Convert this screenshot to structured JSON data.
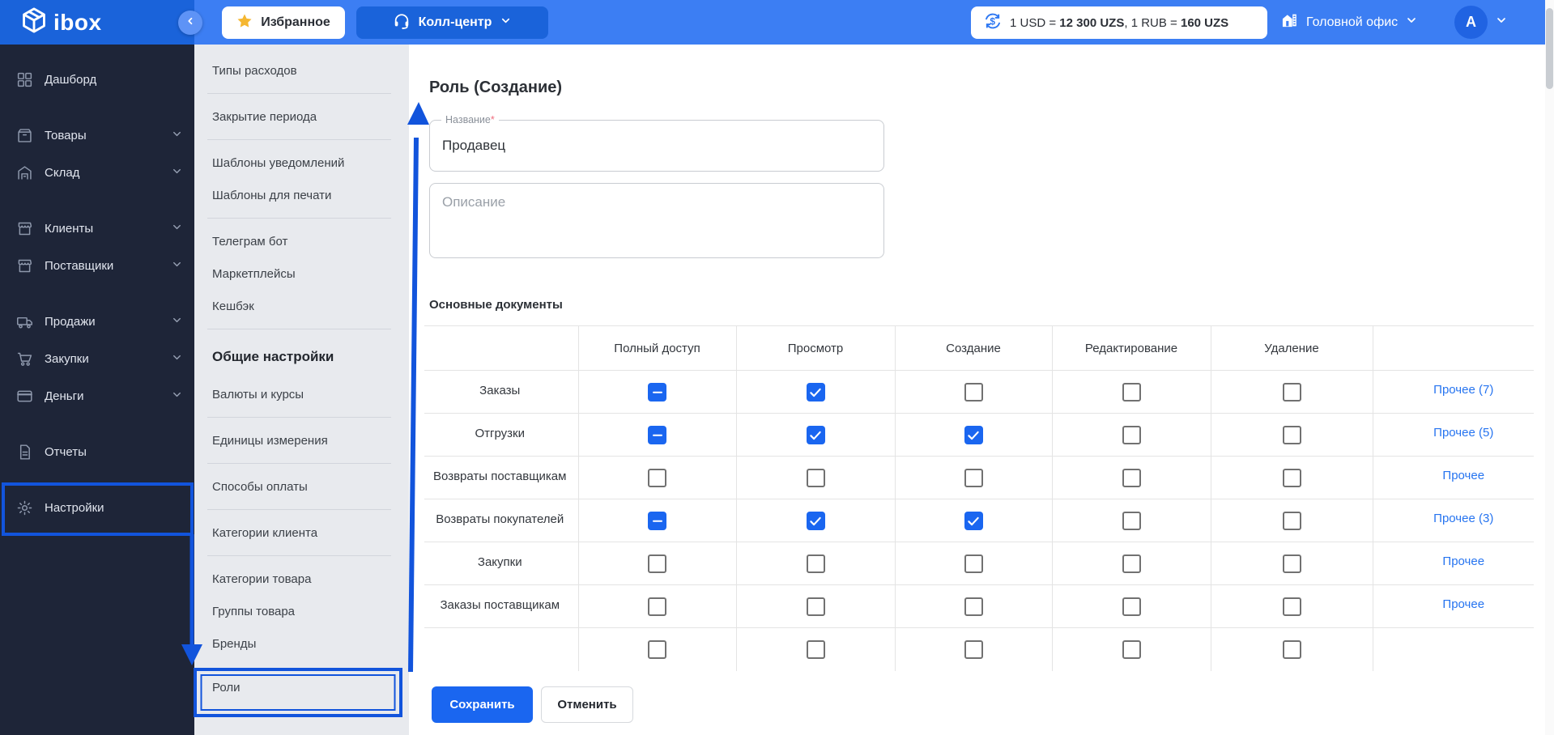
{
  "topbar": {
    "logo_text": "ibox",
    "favorites_label": "Избранное",
    "callcenter_label": "Колл-центр",
    "rates": {
      "r1_label": "1 USD",
      "eq": "=",
      "r1_value": "12 300 UZS",
      "sep": ",",
      "r2_label": "1 RUB",
      "r2_value": "160 UZS"
    },
    "office_label": "Головной офис",
    "avatar_initial": "A"
  },
  "sidebar": {
    "items": [
      {
        "label": "Дашборд",
        "icon": "dashboard-grid-icon",
        "chevron": false,
        "gap": false
      },
      {
        "label": "Товары",
        "icon": "products-box-icon",
        "chevron": true,
        "gap": true
      },
      {
        "label": "Склад",
        "icon": "warehouse-icon",
        "chevron": true,
        "gap": false
      },
      {
        "label": "Клиенты",
        "icon": "clients-store-icon",
        "chevron": true,
        "gap": true
      },
      {
        "label": "Поставщики",
        "icon": "suppliers-store-icon",
        "chevron": true,
        "gap": false
      },
      {
        "label": "Продажи",
        "icon": "sales-truck-icon",
        "chevron": true,
        "gap": true
      },
      {
        "label": "Закупки",
        "icon": "purchases-cart-icon",
        "chevron": true,
        "gap": false
      },
      {
        "label": "Деньги",
        "icon": "money-card-icon",
        "chevron": true,
        "gap": false
      },
      {
        "label": "Отчеты",
        "icon": "reports-doc-icon",
        "chevron": false,
        "gap": true
      },
      {
        "label": "Настройки",
        "icon": "settings-gear-icon",
        "chevron": false,
        "gap": true
      }
    ]
  },
  "settings_menu": {
    "items": [
      {
        "label": "Типы расходов",
        "divider_after": true
      },
      {
        "label": "Закрытие периода",
        "divider_after": true
      },
      {
        "label": "Шаблоны уведомлений",
        "divider_after": false
      },
      {
        "label": "Шаблоны для печати",
        "divider_after": true
      },
      {
        "label": "Телеграм бот",
        "divider_after": false
      },
      {
        "label": "Маркетплейсы",
        "divider_after": false
      },
      {
        "label": "Кешбэк",
        "divider_after": true
      },
      {
        "label": "Общие настройки",
        "header": true
      },
      {
        "label": "Валюты и курсы",
        "divider_after": true
      },
      {
        "label": "Единицы измерения",
        "divider_after": true
      },
      {
        "label": "Способы оплаты",
        "divider_after": true
      },
      {
        "label": "Категории клиента",
        "divider_after": true
      },
      {
        "label": "Категории товара",
        "divider_after": false
      },
      {
        "label": "Группы товара",
        "divider_after": false
      },
      {
        "label": "Бренды",
        "divider_after": false
      }
    ],
    "active_item": "Роли"
  },
  "main": {
    "title": "Роль (Создание)",
    "name_field": {
      "label": "Название",
      "required_mark": "*",
      "value": "Продавец"
    },
    "description_field": {
      "placeholder": "Описание"
    },
    "section_title": "Основные документы",
    "table": {
      "columns": [
        "",
        "Полный доступ",
        "Просмотр",
        "Создание",
        "Редактирование",
        "Удаление",
        ""
      ],
      "rows": [
        {
          "name": "Заказы",
          "states": [
            "indeterminate",
            "checked",
            "unchecked",
            "unchecked",
            "unchecked"
          ],
          "more": "Прочее (7)"
        },
        {
          "name": "Отгрузки",
          "states": [
            "indeterminate",
            "checked",
            "checked",
            "unchecked",
            "unchecked"
          ],
          "more": "Прочее (5)"
        },
        {
          "name": "Возвраты поставщикам",
          "states": [
            "unchecked",
            "unchecked",
            "unchecked",
            "unchecked",
            "unchecked"
          ],
          "more": "Прочее"
        },
        {
          "name": "Возвраты покупателей",
          "states": [
            "indeterminate",
            "checked",
            "checked",
            "unchecked",
            "unchecked"
          ],
          "more": "Прочее (3)"
        },
        {
          "name": "Закупки",
          "states": [
            "unchecked",
            "unchecked",
            "unchecked",
            "unchecked",
            "unchecked"
          ],
          "more": "Прочее"
        },
        {
          "name": "Заказы поставщикам",
          "states": [
            "unchecked",
            "unchecked",
            "unchecked",
            "unchecked",
            "unchecked"
          ],
          "more": "Прочее"
        },
        {
          "name": "",
          "states": [
            "unchecked",
            "unchecked",
            "unchecked",
            "unchecked",
            "unchecked"
          ],
          "more": ""
        }
      ]
    },
    "buttons": {
      "save": "Сохранить",
      "cancel": "Отменить"
    }
  },
  "colors": {
    "topbar": "#3c7ef3",
    "topbar_dark": "#1a63da",
    "sidebar_dark": "#1e2538",
    "sidebar_light": "#e8eaee",
    "checkbox_blue": "#1a66f0",
    "link_blue": "#2674f0",
    "annotation_blue": "#1254dc",
    "star_gold": "#f5b731",
    "save_button": "#1a66f0"
  }
}
